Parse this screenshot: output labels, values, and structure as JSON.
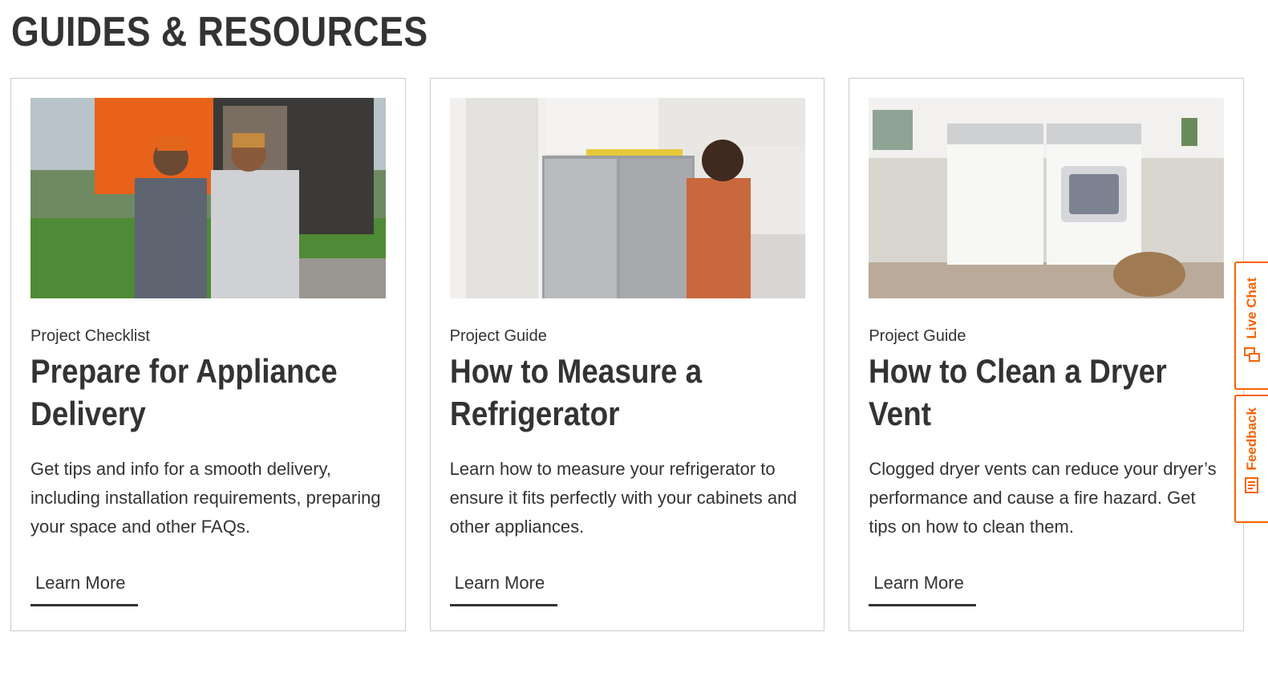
{
  "section": {
    "title": "GUIDES & RESOURCES"
  },
  "cards": [
    {
      "kicker": "Project Checklist",
      "title": "Prepare for Appliance Delivery",
      "description": "Get tips and info for a smooth delivery, including installation requirements, preparing your space and other FAQs.",
      "link": "Learn More",
      "image_alt": "photo-delivery-workers"
    },
    {
      "kicker": "Project Guide",
      "title": "How to Measure a Refrigerator",
      "description": "Learn how to measure your refrigerator to ensure it fits perfectly with your cabinets and other appliances.",
      "link": "Learn More",
      "image_alt": "photo-man-measuring-refrigerator"
    },
    {
      "kicker": "Project Guide",
      "title": "How to Clean a Dryer Vent",
      "description": "Clogged dryer vents can reduce your dryer’s performance and cause a fire hazard. Get tips on how to clean them.",
      "link": "Learn More",
      "image_alt": "photo-laundry-room-washer-dryer"
    }
  ],
  "side_tabs": {
    "live_chat": "Live Chat",
    "feedback": "Feedback"
  },
  "colors": {
    "accent": "#f96302",
    "text": "#333333",
    "border": "#cccccc"
  },
  "icons": {
    "live_chat": "chat-bubbles-icon",
    "feedback": "feedback-form-icon"
  }
}
